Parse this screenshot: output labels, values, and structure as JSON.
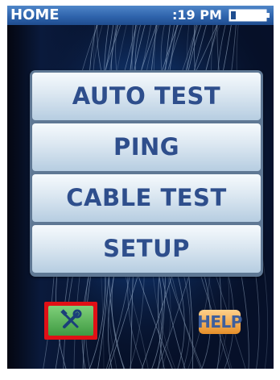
{
  "status_bar": {
    "title": "HOME",
    "time": ":19 PM",
    "battery_level": 0.15
  },
  "menu": {
    "items": [
      {
        "label": "AUTO TEST"
      },
      {
        "label": "PING"
      },
      {
        "label": "CABLE TEST"
      },
      {
        "label": "SETUP"
      }
    ]
  },
  "toolbar": {
    "tools_icon": "wrench-screwdriver-icon",
    "tools_selected": true,
    "help_label": "HELP"
  },
  "colors": {
    "status_bar": "#2f64ad",
    "menu_text": "#2e4e8c",
    "selection_outline": "#e01016",
    "tools_icon_bg": "#4fae4f",
    "help_bg": "#f2a84a"
  }
}
